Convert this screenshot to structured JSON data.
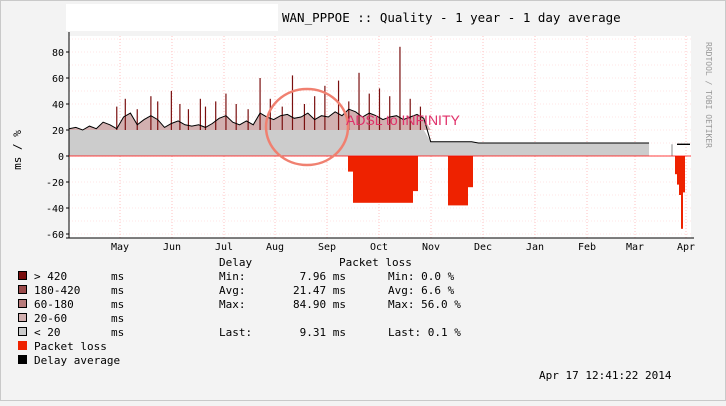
{
  "chart_data": {
    "type": "area",
    "title": "WAN_PPPOE :: Quality - 1 year - 1 day average",
    "ylabel": "ms / %",
    "watermark": "RRDTOOL / TOBI OETIKER",
    "annotation": "ADSL to INFINITY",
    "ylim": [
      -60,
      90
    ],
    "yticks": [
      80,
      60,
      40,
      20,
      0,
      -20,
      -40,
      -60
    ],
    "x_tick_labels": [
      "May",
      "Jun",
      "Jul",
      "Aug",
      "Sep",
      "Oct",
      "Nov",
      "Dec",
      "Jan",
      "Feb",
      "Mar",
      "Apr"
    ],
    "grid": true,
    "series": [
      {
        "name": "Delay average",
        "x": [
          0,
          4,
          8,
          12,
          16,
          20,
          24,
          28,
          32,
          36,
          40,
          44,
          48,
          52,
          56,
          60,
          64,
          68,
          72,
          76,
          80,
          84,
          88,
          92,
          96,
          100,
          104,
          108,
          112,
          116,
          120,
          124,
          128,
          132,
          136,
          140,
          144,
          148,
          152,
          156,
          160,
          164,
          168,
          172,
          176,
          180,
          184,
          188,
          192,
          196,
          200,
          204,
          208,
          212,
          216,
          220,
          224,
          228,
          232,
          236,
          240,
          244,
          248,
          252,
          256,
          260,
          264,
          268,
          272,
          276,
          280,
          284,
          288,
          292,
          296,
          300,
          304,
          308,
          312,
          316,
          320,
          324,
          328,
          332,
          336,
          340
        ],
        "values": [
          21,
          22,
          20,
          23,
          21,
          26,
          24,
          21,
          30,
          33,
          24,
          28,
          31,
          28,
          22,
          25,
          27,
          24,
          23,
          24,
          22,
          25,
          29,
          31,
          26,
          24,
          27,
          24,
          33,
          30,
          28,
          31,
          32,
          29,
          30,
          33,
          28,
          31,
          30,
          34,
          31,
          36,
          34,
          30,
          33,
          31,
          28,
          30,
          31,
          28,
          30,
          32,
          29,
          11,
          11,
          11,
          11,
          11,
          11,
          11,
          10,
          10,
          10,
          10,
          10,
          10,
          10,
          10,
          10,
          10,
          10,
          10,
          10,
          10,
          10,
          10,
          10,
          10,
          10,
          10,
          10,
          10,
          10,
          10,
          10,
          10
        ]
      },
      {
        "name": "Packet loss",
        "x": [
          55,
          56,
          57,
          58,
          59,
          60,
          61,
          62,
          63,
          64,
          65,
          66,
          67,
          68,
          75,
          76,
          77,
          78,
          79
        ],
        "values": [
          -12,
          -36,
          -36,
          -36,
          -36,
          -36,
          -36,
          -36,
          -36,
          -36,
          -36,
          -36,
          -36,
          -27,
          -38,
          -38,
          -38,
          -38,
          -24
        ]
      }
    ],
    "legend": [
      {
        "label": "> 420",
        "unit": "ms",
        "color": "#7a0f0f"
      },
      {
        "label": "180-420",
        "unit": "ms",
        "color": "#9a4a4a"
      },
      {
        "label": "60-180",
        "unit": "ms",
        "color": "#b77a7a"
      },
      {
        "label": "20-60",
        "unit": "ms",
        "color": "#d2b0b0"
      },
      {
        "label": "< 20",
        "unit": "ms",
        "color": "#cccccc"
      },
      {
        "label": "Packet loss",
        "unit": "",
        "color": "#ee2200"
      },
      {
        "label": "Delay average",
        "unit": "",
        "color": "#000000"
      }
    ],
    "stats": {
      "delay_header": "Delay",
      "loss_header": "Packet loss",
      "min_label": "Min:",
      "min_delay": "7.96 ms",
      "min_loss": "Min: 0.0 %",
      "avg_label": "Avg:",
      "avg_delay": "21.47 ms",
      "avg_loss": "Avg: 6.6 %",
      "max_label": "Max:",
      "max_delay": "84.90 ms",
      "max_loss": "Max: 56.0 %",
      "last_label": "Last:",
      "last_delay": "9.31 ms",
      "last_loss": "Last: 0.1 %"
    },
    "timestamp": "Apr 17 12:41:22 2014"
  },
  "colors": {
    "background": "#f3f3f3",
    "plot_background": "#ffffff",
    "grid": "#ff9999",
    "annotation": "#e0306a",
    "circle": "#f08070"
  }
}
